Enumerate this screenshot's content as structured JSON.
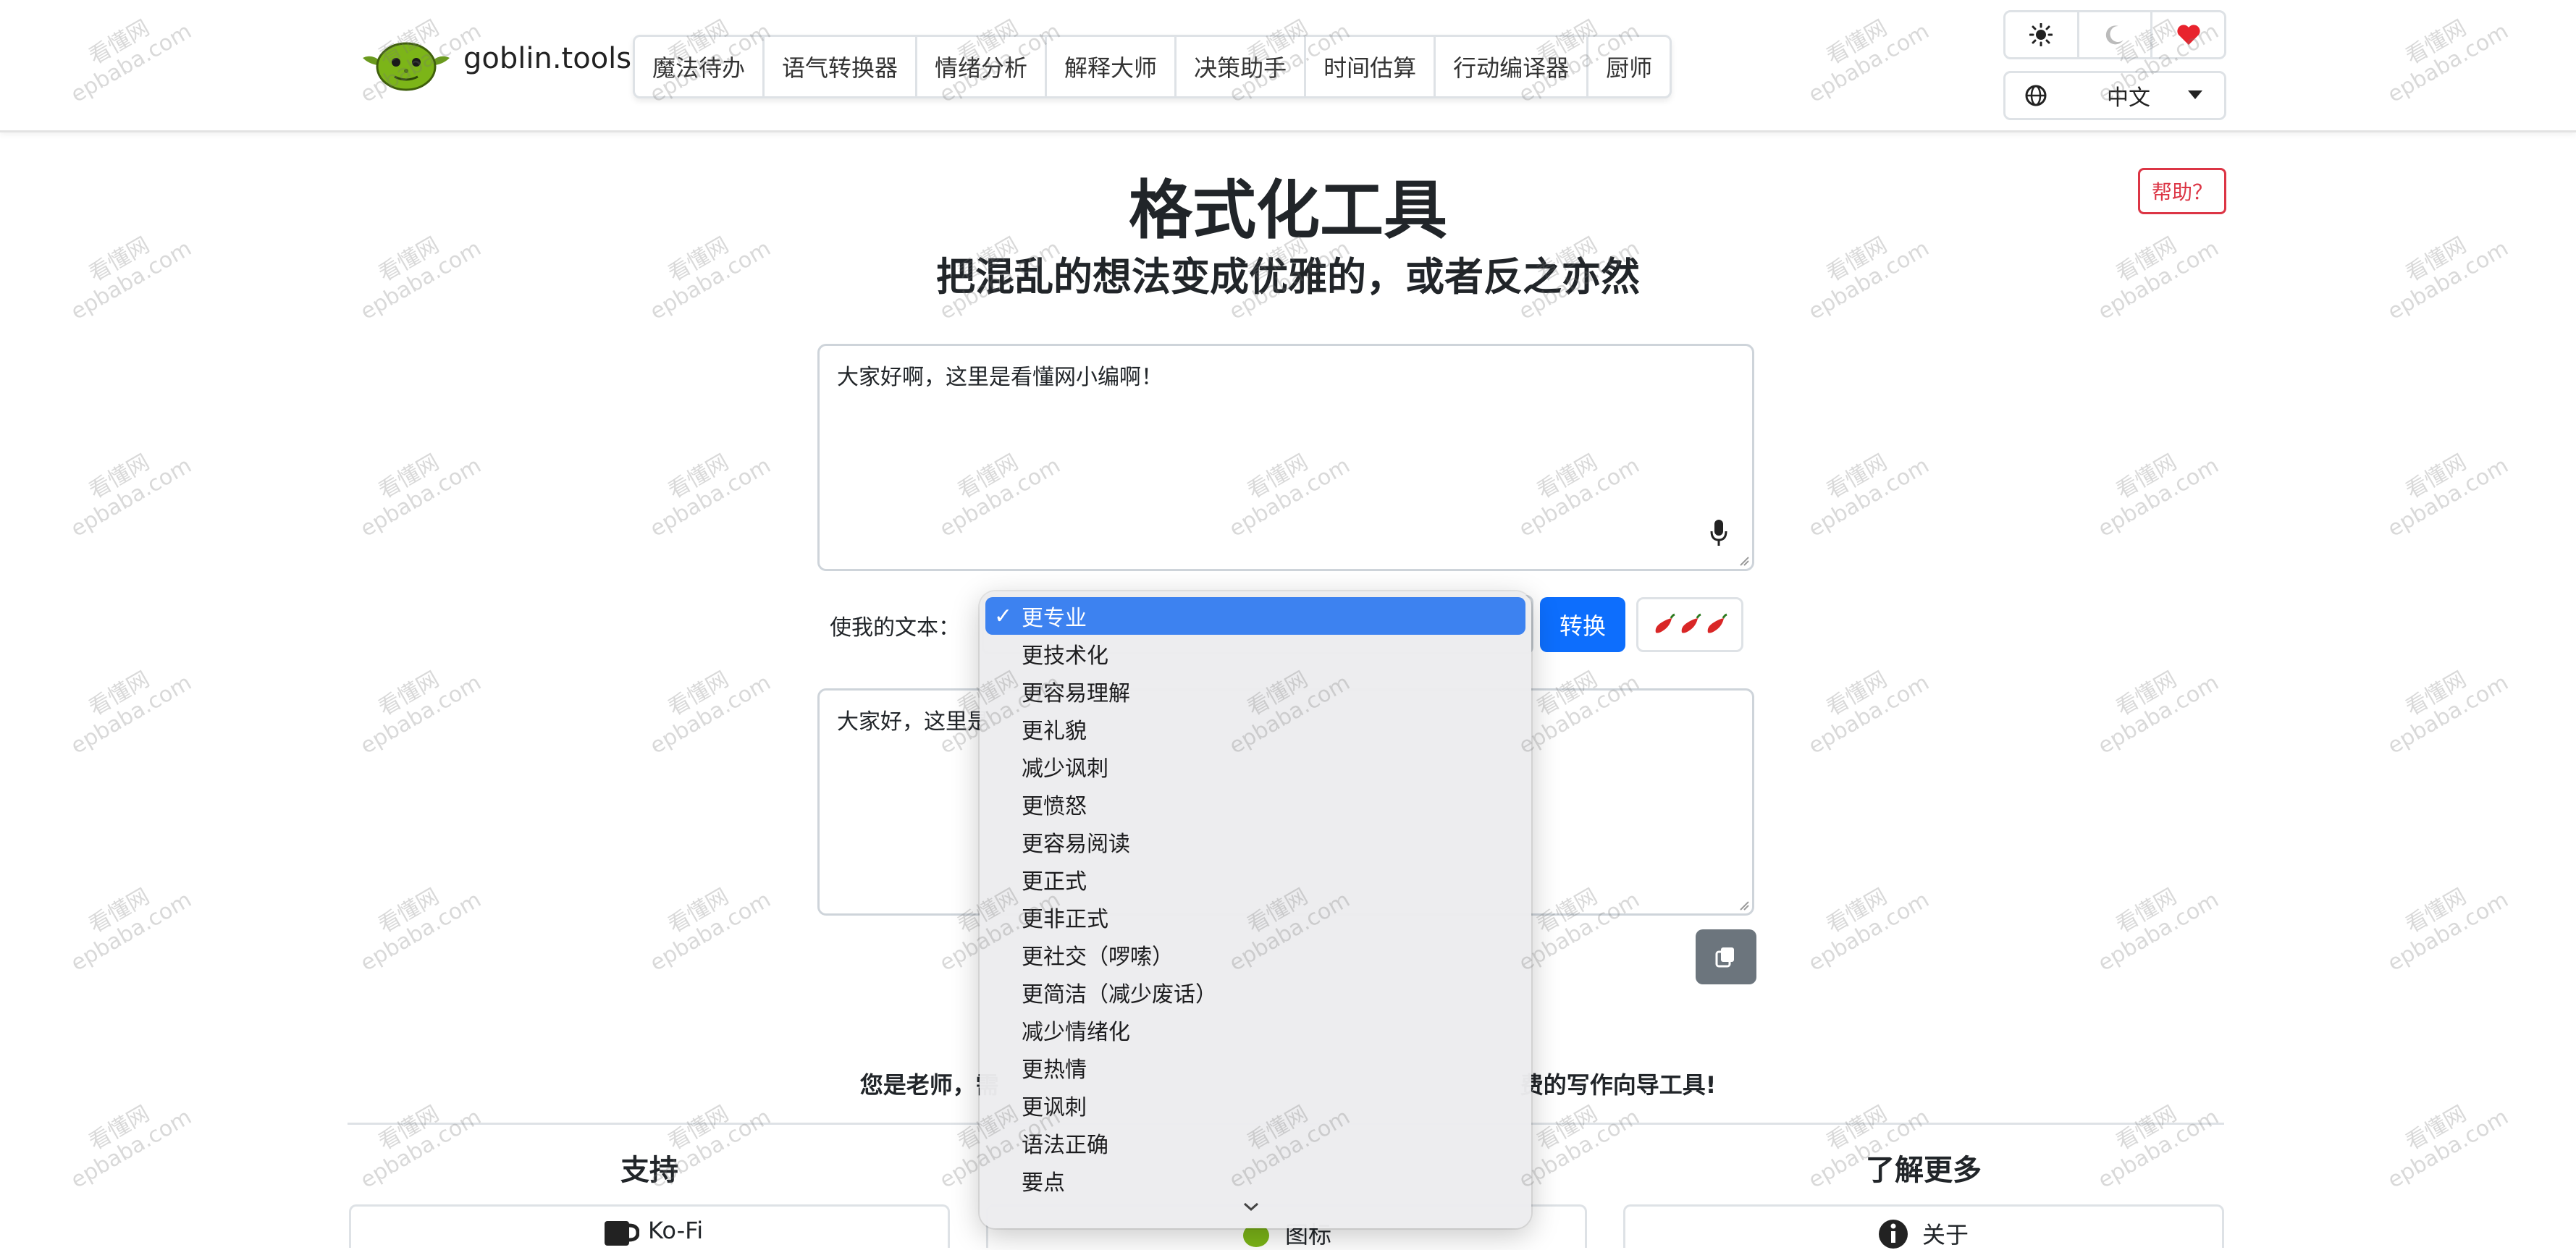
{
  "nav": {
    "brand": "goblin.tools",
    "tabs": [
      "魔法待办",
      "语气转换器",
      "情绪分析",
      "解释大师",
      "决策助手",
      "时间估算",
      "行动编译器",
      "厨师"
    ],
    "theme": {
      "light_icon": "sun-icon",
      "dark_icon": "moon-icon",
      "donate_icon": "heart-icon"
    },
    "language": "中文"
  },
  "help_label": "帮助？",
  "page": {
    "title": "格式化工具",
    "subtitle": "把混乱的想法变成优雅的，或者反之亦然"
  },
  "input": {
    "text": "大家好啊，这里是看懂网小编啊！"
  },
  "control": {
    "label": "使我的文本：",
    "convert": "转换",
    "spice_icon": "chili-pepper-icon"
  },
  "output": {
    "text": "大家好，这里是"
  },
  "teacher_line": {
    "left": "您是老师，需",
    "right": "费的写作向导工具!"
  },
  "footer": {
    "support": "支持",
    "learn_more": "了解更多",
    "kofi": "Ko-Fi",
    "app": "图标",
    "about": "关于"
  },
  "dropdown": {
    "items": [
      "更专业",
      "更技术化",
      "更容易理解",
      "更礼貌",
      "减少讽刺",
      "更愤怒",
      "更容易阅读",
      "更正式",
      "更非正式",
      "更社交（啰嗦）",
      "更简洁（减少废话）",
      "减少情绪化",
      "更热情",
      "更讽刺",
      "语法正确",
      "要点"
    ],
    "selected": "更专业",
    "check": "✓"
  },
  "watermark": {
    "line1": "看懂网",
    "line2": "epbaba.com"
  },
  "colors": {
    "primary": "#0d6efd",
    "danger": "#dc3545",
    "selected": "#3d82f0",
    "goblin": "#7cb518"
  }
}
